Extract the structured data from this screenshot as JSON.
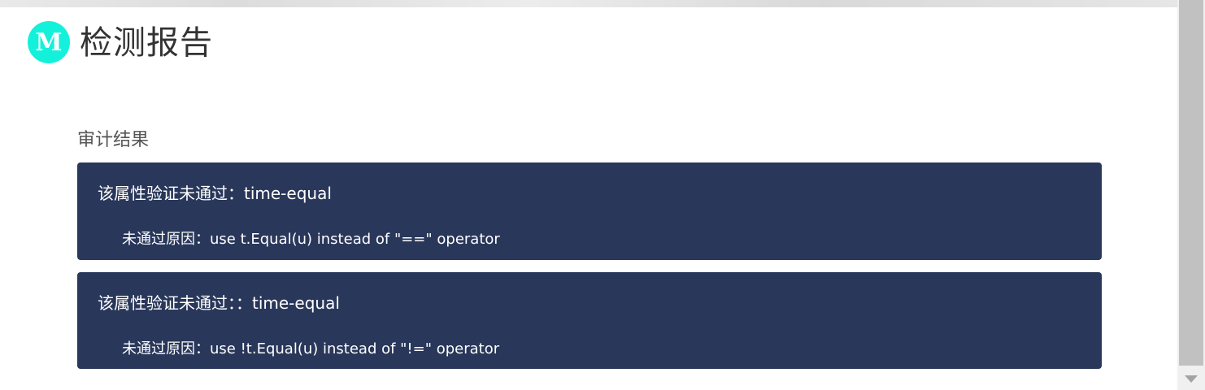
{
  "header": {
    "logo_letter": "M",
    "title": "检测报告"
  },
  "section": {
    "title": "审计结果"
  },
  "results": [
    {
      "title": "该属性验证未通过：time-equal",
      "reason": "未通过原因：use t.Equal(u) instead of \"==\" operator"
    },
    {
      "title": "该属性验证未通过：：time-equal",
      "reason": "未通过原因：use !t.Equal(u) instead of \"!=\" operator"
    }
  ],
  "colors": {
    "logo_bg": "#14f1da",
    "card_bg": "#29375a",
    "title_text": "#333333"
  },
  "icons": {
    "scroll_down": "triangle-down"
  }
}
